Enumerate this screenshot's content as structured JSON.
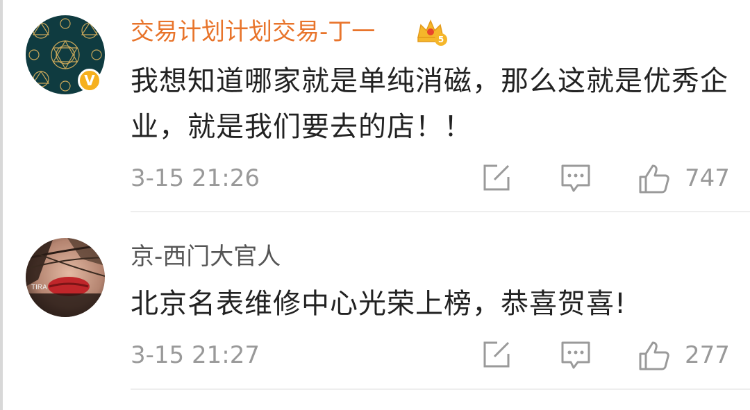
{
  "comments": [
    {
      "username": "交易计划计划交易-丁一",
      "text": "我想知道哪家就是单纯消磁，那么这就是优秀企业，就是我们要去的店！！",
      "time": "3-15 21:26",
      "likes": "747",
      "verified_mark": "V",
      "vip_level": "5",
      "username_color": "#e8742b"
    },
    {
      "username": "京-西门大官人",
      "text": "北京名表维修中心光荣上榜，恭喜贺喜!",
      "time": "3-15 21:27",
      "likes": "277",
      "avatar_text": "TIRA",
      "username_color": "#555555"
    }
  ],
  "icons": {
    "share": "share-edit-icon",
    "comment": "comment-bubble-icon",
    "like": "thumbs-up-icon"
  }
}
